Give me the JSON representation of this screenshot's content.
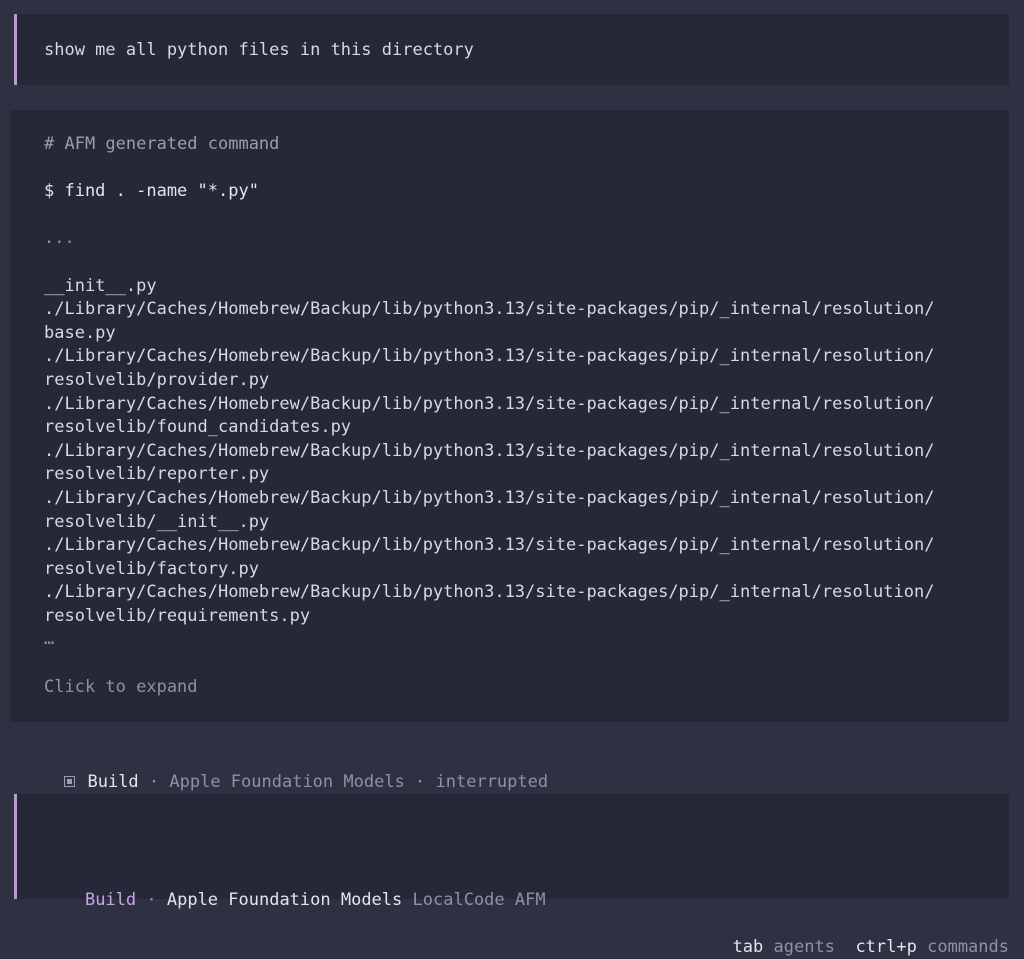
{
  "user_message": "show me all python files in this directory",
  "output": {
    "comment": "# AFM generated command",
    "command": "$ find . -name \"*.py\"",
    "ellipsis_top": "...",
    "lines": [
      "__init__.py",
      "./Library/Caches/Homebrew/Backup/lib/python3.13/site-packages/pip/_internal/resolution/",
      "base.py",
      "./Library/Caches/Homebrew/Backup/lib/python3.13/site-packages/pip/_internal/resolution/",
      "resolvelib/provider.py",
      "./Library/Caches/Homebrew/Backup/lib/python3.13/site-packages/pip/_internal/resolution/",
      "resolvelib/found_candidates.py",
      "./Library/Caches/Homebrew/Backup/lib/python3.13/site-packages/pip/_internal/resolution/",
      "resolvelib/reporter.py",
      "./Library/Caches/Homebrew/Backup/lib/python3.13/site-packages/pip/_internal/resolution/",
      "resolvelib/__init__.py",
      "./Library/Caches/Homebrew/Backup/lib/python3.13/site-packages/pip/_internal/resolution/",
      "resolvelib/factory.py",
      "./Library/Caches/Homebrew/Backup/lib/python3.13/site-packages/pip/_internal/resolution/",
      "resolvelib/requirements.py"
    ],
    "ellipsis_bottom": "…",
    "expand_label": "Click to expand"
  },
  "status": {
    "icon": "stop-square-icon",
    "mode": "Build",
    "separator": " · ",
    "model": "Apple Foundation Models",
    "state": "interrupted"
  },
  "input": {
    "mode": "Build",
    "separator": " · ",
    "model": "Apple Foundation Models",
    "provider": "LocalCode AFM"
  },
  "hints": [
    {
      "key": "tab",
      "desc": "agents"
    },
    {
      "key": "ctrl+p",
      "desc": "commands"
    }
  ],
  "colors": {
    "background": "#2f3143",
    "panel": "#262837",
    "accent": "#b89ad8"
  }
}
